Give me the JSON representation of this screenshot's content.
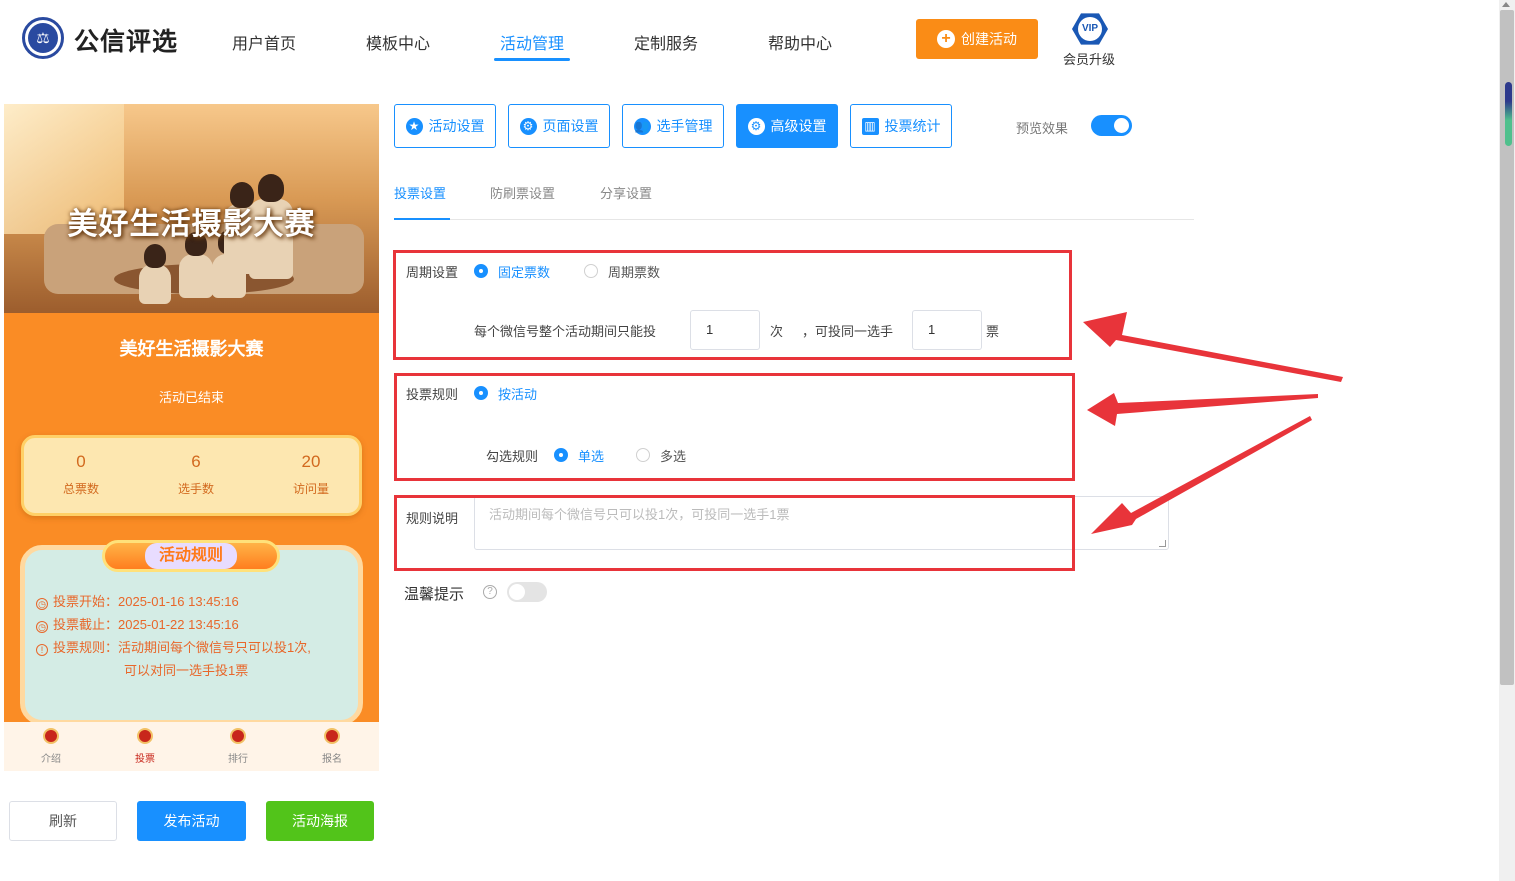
{
  "header": {
    "logo_glyph": "⚖",
    "brand": "公信评选",
    "nav": [
      "用户首页",
      "模板中心",
      "活动管理",
      "定制服务",
      "帮助中心"
    ],
    "active_nav": "活动管理",
    "create_button": "创建活动",
    "vip_badge": "VIP",
    "vip_label": "会员升级"
  },
  "preview": {
    "banner_title": "美好生活摄影大赛",
    "event_title": "美好生活摄影大赛",
    "status": "活动已结束",
    "stats": [
      {
        "value": "0",
        "label": "总票数"
      },
      {
        "value": "6",
        "label": "选手数"
      },
      {
        "value": "20",
        "label": "访问量"
      }
    ],
    "rules_title": "活动规则",
    "rules": {
      "start": "投票开始：2025-01-16 13:45:16",
      "end": "投票截止：2025-01-22 13:45:16",
      "rule_line1": "投票规则：活动期间每个微信号只可以投1次,",
      "rule_line2": "可以对同一选手投1票"
    },
    "tabbar": [
      "介绍",
      "投票",
      "排行",
      "报名"
    ],
    "active_tab": "投票"
  },
  "bottom_buttons": {
    "refresh": "刷新",
    "publish": "发布活动",
    "poster": "活动海报"
  },
  "toolbar": {
    "items": [
      {
        "label": "活动设置",
        "icon": "star-icon"
      },
      {
        "label": "页面设置",
        "icon": "gear-icon"
      },
      {
        "label": "选手管理",
        "icon": "users-icon"
      },
      {
        "label": "高级设置",
        "icon": "settings-sliders-icon"
      },
      {
        "label": "投票统计",
        "icon": "bar-chart-icon"
      }
    ],
    "active": "高级设置",
    "preview_label": "预览效果",
    "preview_on": true
  },
  "subtabs": {
    "items": [
      "投票设置",
      "防刷票设置",
      "分享设置"
    ],
    "active": "投票设置"
  },
  "form": {
    "cycle": {
      "label": "周期设置",
      "options": [
        "固定票数",
        "周期票数"
      ],
      "selected": "固定票数",
      "sentence_prefix": "每个微信号整个活动期间只能投",
      "times_value": "1",
      "times_unit": "次",
      "sentence_mid": "，可投同一选手",
      "votes_value": "1",
      "votes_unit": "票"
    },
    "vote_rule": {
      "label": "投票规则",
      "option": "按活动",
      "select_label": "勾选规则",
      "select_options": [
        "单选",
        "多选"
      ],
      "selected": "单选"
    },
    "rule_desc": {
      "label": "规则说明",
      "placeholder": "活动期间每个微信号只可以投1次，可投同一选手1票"
    },
    "tip": {
      "label": "温馨提示",
      "help_glyph": "?",
      "enabled": false
    }
  },
  "colors": {
    "primary": "#1890ff",
    "orange": "#fa8c16",
    "green": "#52c41a",
    "highlight_red": "#e8343a"
  }
}
